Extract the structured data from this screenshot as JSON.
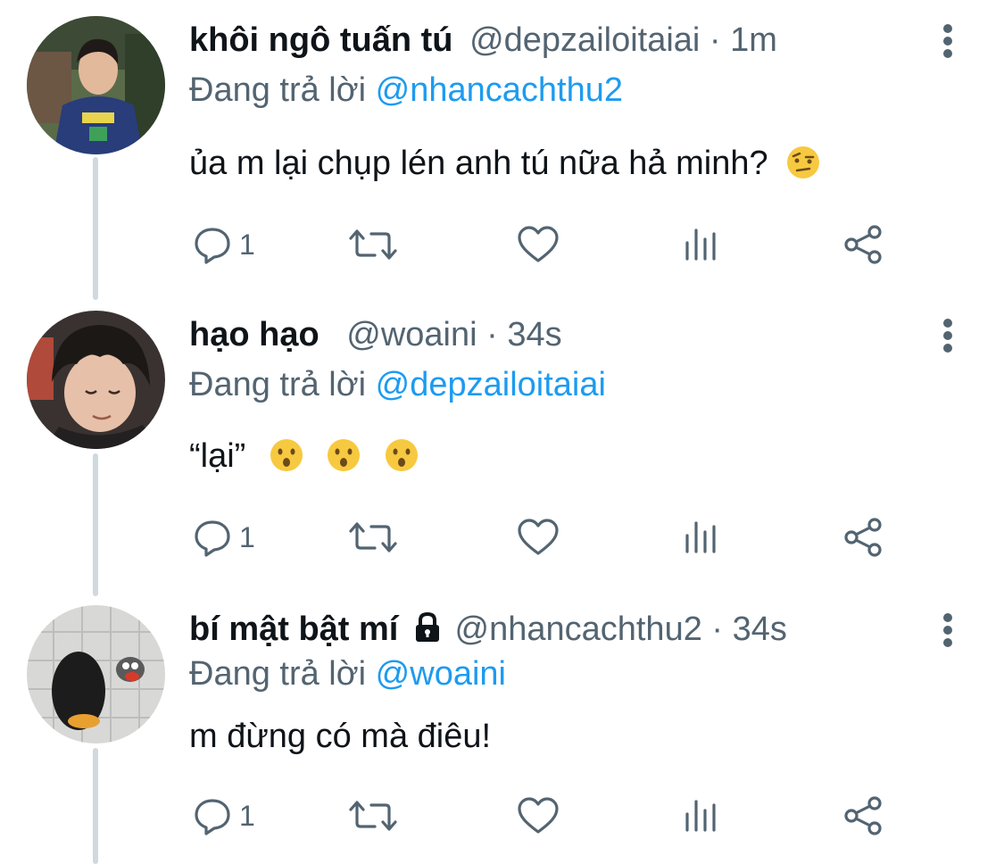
{
  "tweets": [
    {
      "name": "khôi ngô tuấn tú",
      "handle": "@depzailoitaiai",
      "separator": "·",
      "time": "1m",
      "replying_prefix": "Đang trả lời",
      "replying_to": "@nhancachthu2",
      "text": "ủa m lại chụp lén anh tú nữa hả minh?",
      "emojis": [
        "face-with-raised-eyebrow"
      ],
      "reply_count": "1",
      "locked": false
    },
    {
      "name": "hạo hạo",
      "handle": "@woaini",
      "separator": "·",
      "time": "34s",
      "replying_prefix": "Đang trả lời",
      "replying_to": "@depzailoitaiai",
      "text": "“lại”",
      "emojis": [
        "hushed-face",
        "hushed-face",
        "hushed-face"
      ],
      "reply_count": "1",
      "locked": false
    },
    {
      "name": "bí mật bật mí",
      "handle": "@nhancachthu2",
      "separator": "·",
      "time": "34s",
      "replying_prefix": "Đang trả lời",
      "replying_to": "@woaini",
      "text": "m đừng có mà điêu!",
      "emojis": [],
      "reply_count": "1",
      "locked": true
    }
  ],
  "icons": {
    "reply": "speech-bubble-icon",
    "retweet": "retweet-icon",
    "like": "heart-icon",
    "views": "bar-chart-icon",
    "share": "share-icon",
    "more": "vertical-dots-icon",
    "lock": "lock-icon"
  },
  "colors": {
    "text": "#0f1419",
    "secondary": "#536471",
    "mention": "#1d9bf0",
    "thread_line": "#cfd9de"
  }
}
